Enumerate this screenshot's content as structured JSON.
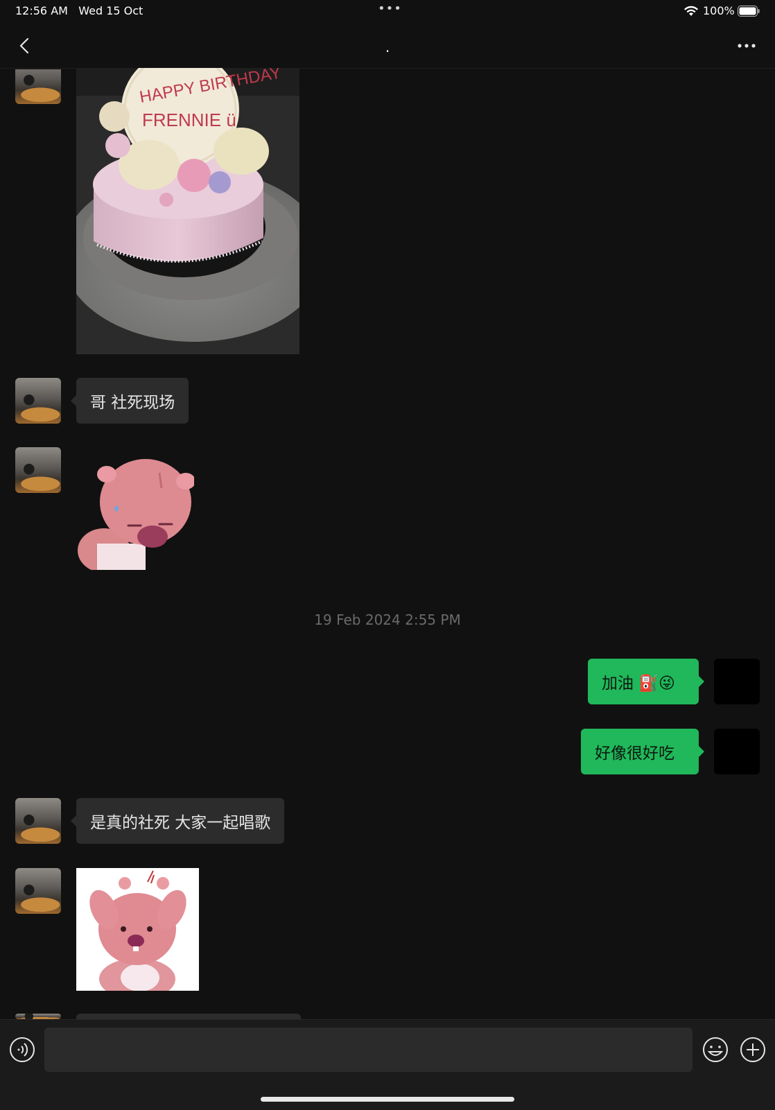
{
  "status_bar": {
    "time": "12:56 AM",
    "date": "Wed 15 Oct",
    "center_indicator": "•••",
    "battery_percent": "100%"
  },
  "header": {
    "title": "."
  },
  "messages": [
    {
      "sender": "peer",
      "type": "image",
      "content": "cake-photo",
      "caption": "HAPPY BIRTHDAY FRENNIE ü"
    },
    {
      "sender": "peer",
      "type": "text",
      "text": "哥 社死现场"
    },
    {
      "sender": "peer",
      "type": "sticker",
      "content": "pink-beaver-sweating"
    },
    {
      "type": "timestamp",
      "text": "19 Feb 2024 2:55 PM"
    },
    {
      "sender": "self",
      "type": "text",
      "text": "加油 ⛽😜"
    },
    {
      "sender": "self",
      "type": "text",
      "text": "好像很好吃"
    },
    {
      "sender": "peer",
      "type": "text",
      "text": "是真的社死 大家一起唱歌"
    },
    {
      "sender": "peer",
      "type": "sticker",
      "content": "pink-beaver-holding-head"
    }
  ],
  "input": {
    "placeholder": "",
    "value": ""
  },
  "icons": {
    "back": "chevron-left-icon",
    "more": "ellipsis-icon",
    "voice": "voice-icon",
    "emoji": "emoji-icon",
    "add": "plus-icon"
  },
  "colors": {
    "background": "#111111",
    "incoming_bubble": "#2c2c2c",
    "outgoing_bubble": "#20b85a"
  }
}
